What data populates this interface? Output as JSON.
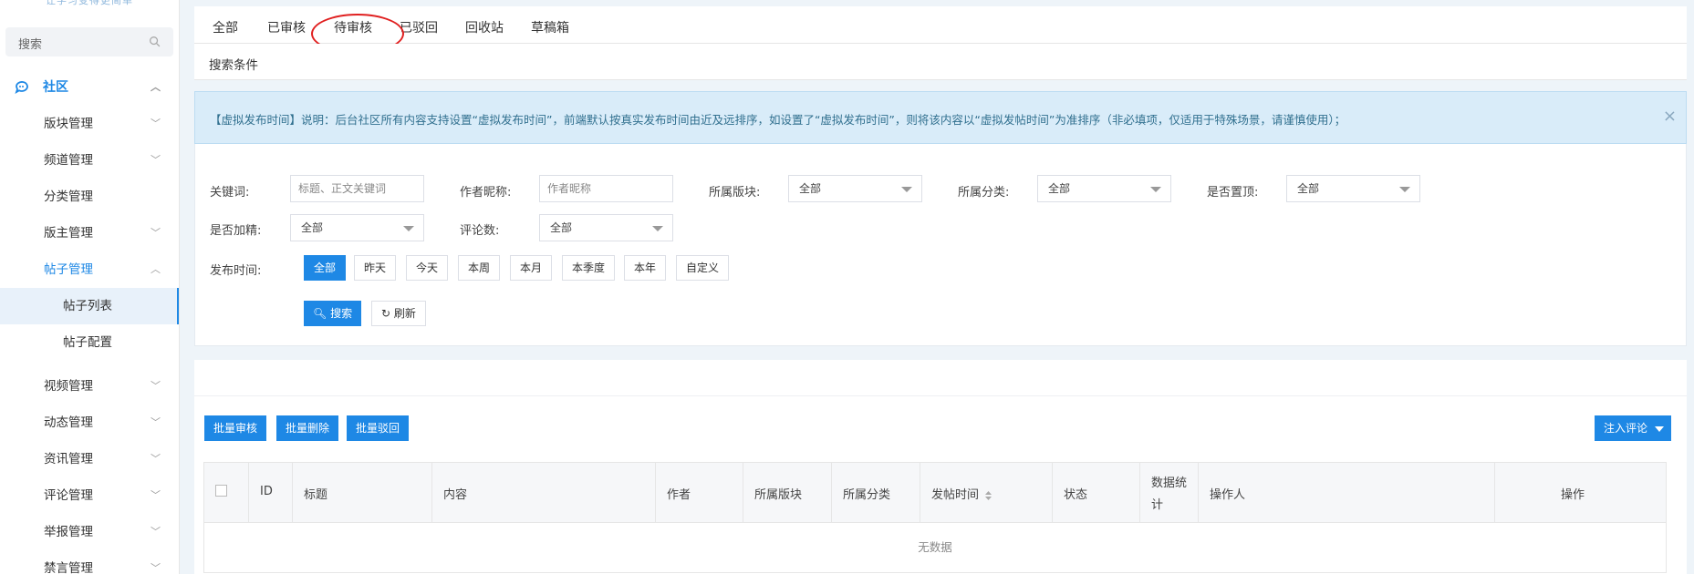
{
  "sidebar": {
    "logo_text": "让学习变得更简单",
    "search_placeholder": "搜索",
    "section": "社区",
    "items": [
      {
        "label": "版块管理"
      },
      {
        "label": "频道管理"
      },
      {
        "label": "分类管理"
      },
      {
        "label": "版主管理"
      },
      {
        "label": "帖子管理"
      },
      {
        "label": "帖子列表"
      },
      {
        "label": "帖子配置"
      },
      {
        "label": "视频管理"
      },
      {
        "label": "动态管理"
      },
      {
        "label": "资讯管理"
      },
      {
        "label": "评论管理"
      },
      {
        "label": "举报管理"
      },
      {
        "label": "禁言管理"
      }
    ]
  },
  "tabs": [
    "全部",
    "已审核",
    "待审核",
    "已驳回",
    "回收站",
    "草稿箱"
  ],
  "active_tab": "待审核",
  "search_conditions_label": "搜索条件",
  "notice": {
    "text": "【虚拟发布时间】说明：后台社区所有内容支持设置“虚拟发布时间”，前端默认按真实发布时间由近及远排序，如设置了“虚拟发布时间”，则将该内容以“虚拟发帖时间”为准排序（非必填项，仅适用于特殊场景，请谨慎使用）；",
    "close": "×"
  },
  "filters": {
    "keyword_label": "关键词:",
    "keyword_placeholder": "标题、正文关键词",
    "author_label": "作者昵称:",
    "author_placeholder": "作者昵称",
    "block_label": "所属版块:",
    "block_value": "全部",
    "category_label": "所属分类:",
    "category_value": "全部",
    "top_label": "是否置顶:",
    "top_value": "全部",
    "featured_label": "是否加精:",
    "featured_value": "全部",
    "comments_label": "评论数:",
    "comments_value": "全部",
    "time_label": "发布时间:",
    "time_options": [
      "全部",
      "昨天",
      "今天",
      "本周",
      "本月",
      "本季度",
      "本年",
      "自定义"
    ],
    "search_button": "搜索",
    "refresh_button": "刷新"
  },
  "actions": {
    "batch_approve": "批量审核",
    "batch_delete": "批量删除",
    "batch_reject": "批量驳回",
    "inject_comment": "注入评论"
  },
  "table": {
    "columns": [
      "ID",
      "标题",
      "内容",
      "作者",
      "所属版块",
      "所属分类",
      "发帖时间",
      "状态",
      "数据统计",
      "操作人",
      "操作"
    ],
    "empty_text": "无数据"
  },
  "colors": {
    "accent": "#1e88e5",
    "highlight_circle": "#e02020",
    "notice_bg": "#d9ecf9"
  }
}
